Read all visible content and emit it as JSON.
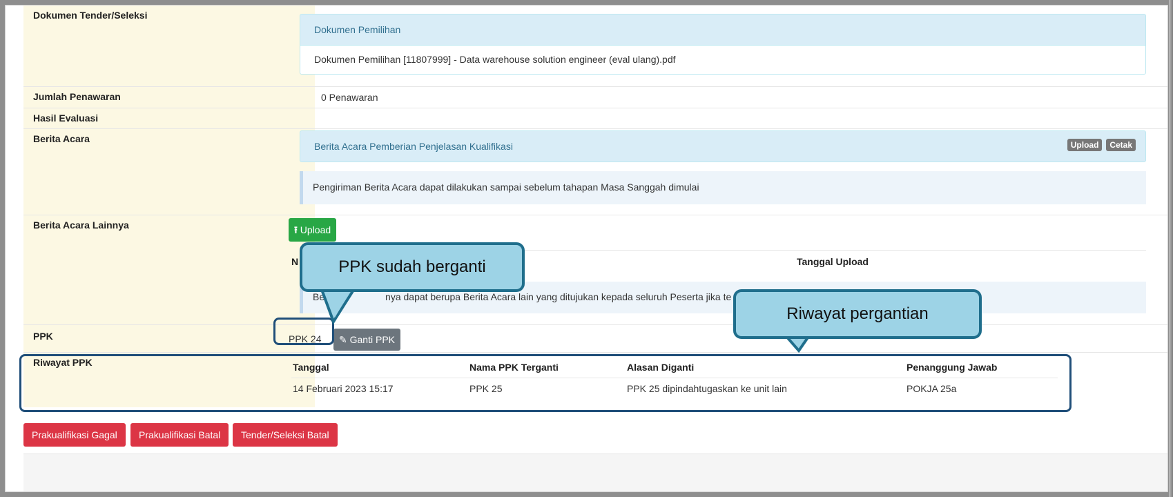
{
  "rows": {
    "dokumen": {
      "label": "Dokumen Tender/Seleksi",
      "panel_title": "Dokumen Pemilihan",
      "file": "Dokumen Pemilihan [11807999] - Data warehouse solution engineer (eval ulang).pdf"
    },
    "jumlah": {
      "label": "Jumlah Penawaran",
      "value": "0 Penawaran"
    },
    "hasil": {
      "label": "Hasil Evaluasi"
    },
    "berita": {
      "label": "Berita Acara",
      "panel_title": "Berita Acara Pemberian Penjelasan Kualifikasi",
      "upload_label": "Upload",
      "cetak_label": "Cetak",
      "info": "Pengiriman Berita Acara dapat dilakukan sampai sebelum tahapan Masa Sanggah dimulai"
    },
    "berita_lain": {
      "label": "Berita Acara Lainnya",
      "upload_button": "Upload",
      "col_nama": "N",
      "col_tanggal": "Tanggal Upload",
      "info_start": "Berita A",
      "info_mid": "nya dapat berupa Berita Acara lain yang ditujukan kepada seluruh Peserta jika te"
    },
    "ppk": {
      "label": "PPK",
      "value": "PPK 24",
      "ganti_button": "Ganti PPK"
    },
    "riwayat": {
      "label": "Riwayat PPK",
      "headers": [
        "Tanggal",
        "Nama PPK Terganti",
        "Alasan Diganti",
        "Penanggung Jawab"
      ],
      "rows": [
        [
          "14 Februari 2023 15:17",
          "PPK 25",
          "PPK 25 dipindahtugaskan ke unit lain",
          "POKJA 25a"
        ]
      ]
    }
  },
  "actions": {
    "gagal": "Prakualifikasi Gagal",
    "batal": "Prakualifikasi Batal",
    "tender_batal": "Tender/Seleksi Batal"
  },
  "callouts": {
    "ppk_changed": "PPK sudah berganti",
    "history": "Riwayat pergantian"
  },
  "colors": {
    "label_bg": "#fcf8e3",
    "panel_head_bg": "#d9edf7",
    "success": "#28a745",
    "danger": "#dc3545",
    "callout_fill": "#9dd3e6",
    "callout_border": "#1f6e8c",
    "highlight": "#1f4e79"
  }
}
